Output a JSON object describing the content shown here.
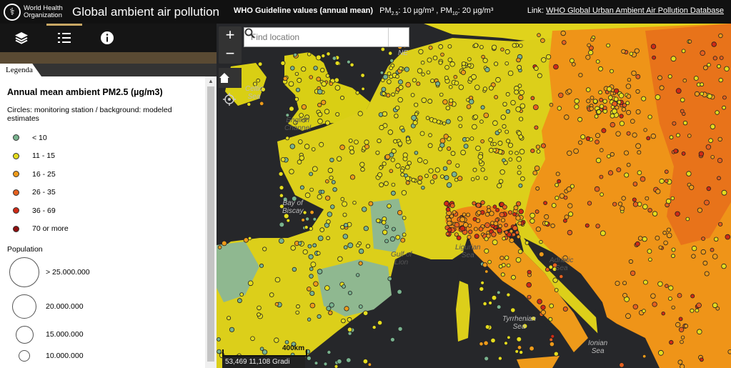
{
  "header": {
    "org_name": "World Health Organization",
    "title": "Global ambient air pollution",
    "guideline_label": "WHO Guideline values (annual mean)",
    "pm25_label": "PM2.5",
    "pm25_value": ": 10 µg/m³",
    "pm10_label": "PM10",
    "pm10_value": ": 20 µg/m³",
    "link_prefix": "Link:",
    "link_text": "WHO Global Urban Ambient Air Pollution Database"
  },
  "toolbar": {
    "layers_icon": "layers-icon",
    "legend_icon": "legend-list-icon",
    "info_icon": "info-icon"
  },
  "legend": {
    "tab_label": "Legenda",
    "title": "Annual mean ambient PM2.5 (µg/m3)",
    "subtitle": "Circles: monitoring station / background: modeled estimates",
    "classes": [
      {
        "label": "< 10",
        "color": "#79b38f"
      },
      {
        "label": "11 - 15",
        "color": "#e4dc1e"
      },
      {
        "label": "16 - 25",
        "color": "#ee9b1a"
      },
      {
        "label": "26 - 35",
        "color": "#e5601f"
      },
      {
        "label": "36 - 69",
        "color": "#cf2a16"
      },
      {
        "label": "70 or more",
        "color": "#8e1010"
      }
    ],
    "population_title": "Population",
    "population": [
      {
        "label": "> 25.000.000"
      },
      {
        "label": "20.000.000"
      },
      {
        "label": "15.000.000"
      },
      {
        "label": "10.000.000"
      }
    ]
  },
  "map": {
    "search_placeholder": "Find location",
    "zoom_in": "+",
    "zoom_out": "−",
    "scale_label": "400km",
    "coordinates": "53,469 11,108 Gradi",
    "labels": {
      "celtic_sea": "Celtic\nSea",
      "english_channel": "English\nChannel",
      "bay_of_biscay": "Bay of\nBiscay",
      "gulf_of_lion": "Gulf of\nLion",
      "ligurian_sea": "Ligurian\nSea",
      "adriatic_sea": "Adriatic\nSea",
      "tyrrhenian_sea": "Tyrrhenian\nSea",
      "ionian_sea": "Ionian\nSea",
      "ne": "NE"
    }
  }
}
